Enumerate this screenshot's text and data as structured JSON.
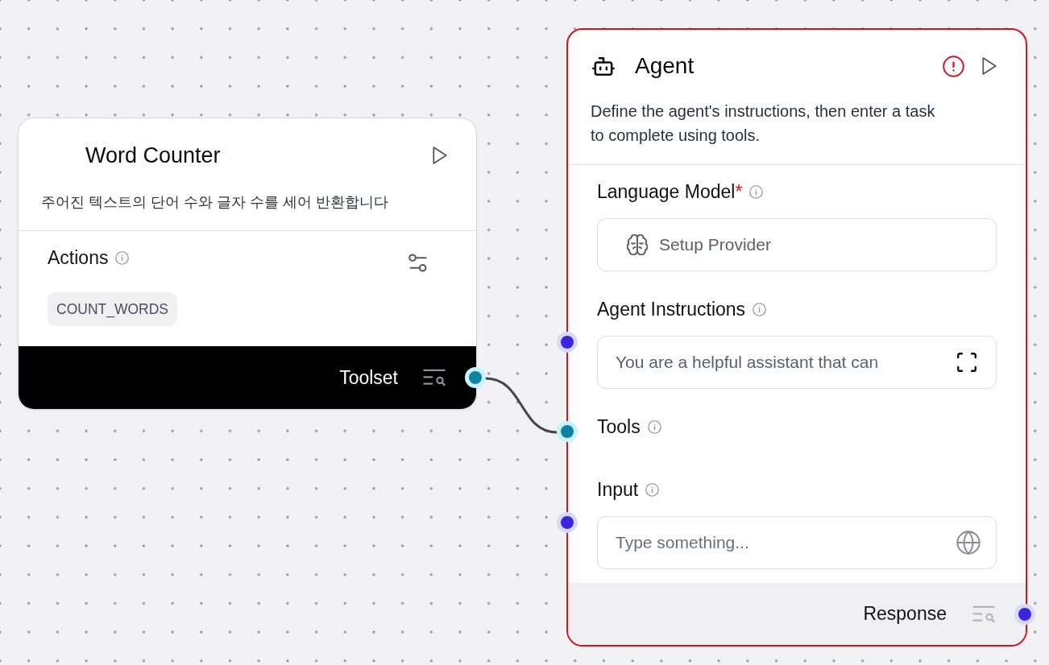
{
  "tool_node": {
    "title": "Word Counter",
    "description": "주어진 텍스트의 단어 수와 글자 수를 세어 반환합니다",
    "actions_label": "Actions",
    "actions": [
      "COUNT_WORDS"
    ],
    "output": {
      "label": "Toolset",
      "handle": {
        "kind": "tool"
      },
      "connected": true
    }
  },
  "agent_node": {
    "title": "Agent",
    "has_error": true,
    "description": "Define the agent's instructions, then enter a task to complete using tools.",
    "fields": [
      {
        "kind": "provider",
        "label": "Language Model",
        "required_mark": "*",
        "button": "Setup Provider"
      },
      {
        "kind": "textarea",
        "label": "Agent Instructions",
        "handle": {
          "kind": "data"
        },
        "value": "You are a helpful assistant that can"
      },
      {
        "kind": "plain",
        "label": "Tools",
        "handle": {
          "kind": "tool"
        },
        "connected": true
      },
      {
        "kind": "text",
        "label": "Input",
        "handle": {
          "kind": "data"
        },
        "placeholder": "Type something..."
      }
    ],
    "output": {
      "label": "Response",
      "handle": {
        "kind": "data"
      }
    }
  }
}
